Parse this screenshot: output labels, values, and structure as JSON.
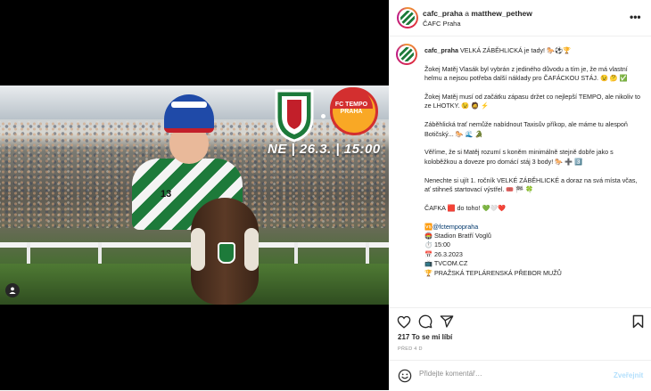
{
  "header": {
    "user1": "cafc_praha",
    "joiner": "a",
    "user2": "matthew_pethew",
    "subtitle": "ČAFC Praha",
    "more_icon": "more-horizontal-icon"
  },
  "media": {
    "match_text": "NE | 26.3. | 15:00",
    "right_badge_line1": "FC TEMPO",
    "right_badge_line2": "PRAHA",
    "jersey_number": "13",
    "tag_icon": "user-tag-icon"
  },
  "caption": {
    "username": "cafc_praha",
    "headline": "VELKÁ ZÁBĚHLICKÁ je tady! 🐎⚽🏆",
    "p1": "Žokej Matěj Vlasák byl vybrán z jediného důvodu a tím je, že má vlastní helmu a nejsou potřeba další náklady pro ČAFÁCKOU STÁJ. 😉 🤔 ✅",
    "p2": "Žokej Matěj musí od začátku zápasu držet co nejlepší TEMPO, ale nikoliv to ze LHOTKY. 😉 🧔 ⚡",
    "p3": "Záběhlická trať nemůže nabídnout Taxisův příkop, ale máme tu alespoň Botičský... 🐎 🌊 🐊",
    "p4": "Věříme, že si Matěj rozumí s koněm minimálně stejně dobře jako s koloběžkou a doveze pro domácí stáj 3 body! 🐎 ➕ 3️⃣",
    "p5": "Nenechte si ujít 1. ročník VELKÉ ZÁBĚHLICKÉ a doraz na svá místa včas, ať stihneš startovací výstřel. 🎟️ 🏁 🍀",
    "p6": "ČAFKA 🟥 do toho! 💚🤍❤️",
    "info_mention": "@fctempopraha",
    "info_mention_prefix": "🆚",
    "info_stadium": "🏟️ Stadion Bratří Voglů",
    "info_time": "⏱️ 15:00",
    "info_date": "📅 26.3.2023",
    "info_tv": "📺 TVCOM.CZ",
    "info_league": "🏆 PRAŽSKÁ TEPLÁRENSKÁ PŘEBOR MUŽŮ"
  },
  "actions": {
    "like_icon": "heart-icon",
    "comment_icon": "comment-icon",
    "share_icon": "send-icon",
    "save_icon": "bookmark-icon"
  },
  "likes": "217 To se mi líbí",
  "timestamp": "PŘED 4 D",
  "comment": {
    "placeholder": "Přidejte komentář…",
    "post_label": "Zveřejnit",
    "emoji_icon": "emoji-icon"
  },
  "colors": {
    "club_green": "#1d7a3a",
    "tempo_red": "#d32f2f",
    "tempo_yellow": "#f9a825",
    "link_blue": "#00376b",
    "post_button": "#b2dffc"
  }
}
